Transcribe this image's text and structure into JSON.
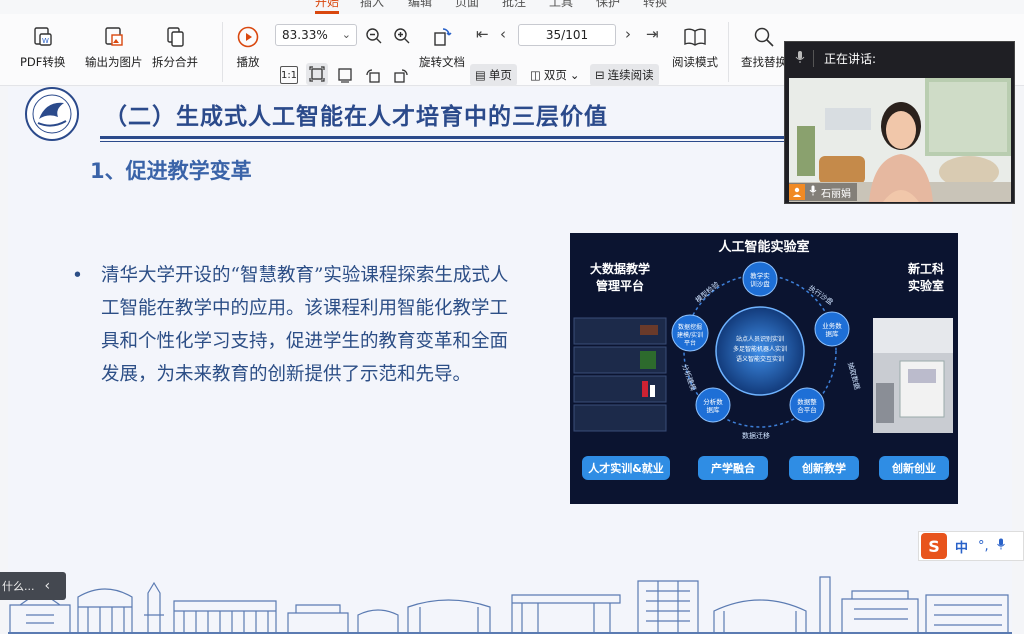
{
  "top_tabs": [
    "开始",
    "插入",
    "编辑",
    "页面",
    "批注",
    "工具",
    "保护",
    "转换"
  ],
  "ribbon": {
    "pdf_convert": "PDF转换",
    "export_image": "输出为图片",
    "split_merge": "拆分合并",
    "play": "播放",
    "zoom_value": "83.33%",
    "page_value": "35/101",
    "rotate_doc": "旋转文档",
    "single_page": "单页",
    "double_page": "双页",
    "continuous_read": "连续阅读",
    "read_mode": "阅读模式",
    "find_replace": "查找替换"
  },
  "slide": {
    "title": "（二）生成式人工智能在人才培育中的三层价值",
    "subtitle": "1、促进教学变革",
    "bullet_text": "清华大学开设的“智慧教育”实验课程探索生成式人工智能在教学中的应用。该课程利用智能化教学工具和个性化学习支持，促进学生的教育变革和全面发展，为未来教育的创新提供了示范和先导。",
    "poster": {
      "title": "人工智能实验室",
      "left_heading": "大数据教学\n管理平台",
      "right_heading": "新工科\n实验室",
      "nodes": [
        "教学实训沙盘",
        "业务数据库",
        "数据整合平台",
        "分析数据库",
        "数据挖掘建模/实训平台"
      ],
      "center_text": "站点人员识别实训\n多足智能机器人实训\n语义智能交互实训",
      "arc_labels": [
        "执行沙盘",
        "抽取数据",
        "数据迁移",
        "分析建模",
        "模型检验"
      ],
      "buttons": [
        "人才实训&就业",
        "产学融合",
        "创新教学",
        "创新创业"
      ]
    }
  },
  "video": {
    "speaking_label": "正在讲话:",
    "speaker_name": "石丽娟"
  },
  "ime": {
    "mode": "中"
  },
  "prev_tab_text": "什么..."
}
